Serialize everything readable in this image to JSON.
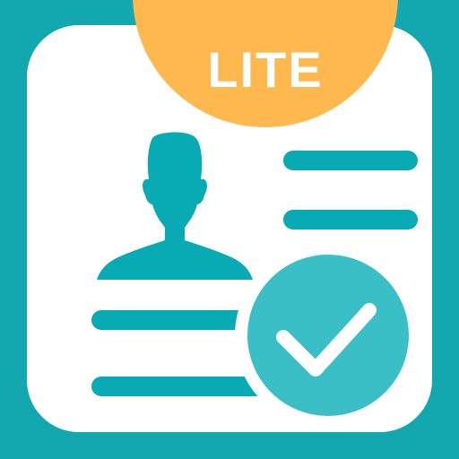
{
  "badge": {
    "label": "LITE"
  },
  "colors": {
    "background": "#13a8b0",
    "card": "#ffffff",
    "badge": "#ffb84d",
    "accent": "#08aab4",
    "check_circle": "#3bbfc6"
  },
  "icons": {
    "profile": "person-silhouette-icon",
    "verified": "checkmark-icon"
  }
}
